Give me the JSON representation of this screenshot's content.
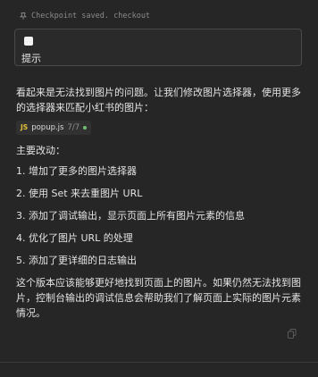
{
  "checkpoint": {
    "text": "Checkpoint saved. checkout"
  },
  "prompt": {
    "label": "提示"
  },
  "message": {
    "intro": "看起来是无法找到图片的问题。让我们修改图片选择器，使用更多的选择器来匹配小红书的图片：",
    "file": {
      "badge": "JS",
      "name": "popup.js",
      "meta": "7/7"
    },
    "heading": "主要改动：",
    "changes": [
      "1. 增加了更多的图片选择器",
      "2. 使用 Set 来去重图片 URL",
      "3. 添加了调试输出，显示页面上所有图片元素的信息",
      "4. 优化了图片 URL 的处理",
      "5. 添加了更详细的日志输出"
    ],
    "summary": "这个版本应该能够更好地找到页面上的图片。如果仍然无法找到图片，控制台输出的调试信息会帮助我们了解页面上实际的图片元素情况。"
  },
  "icons": {
    "checkpoint": "pin-icon",
    "copy": "copy-icon"
  },
  "colors": {
    "background": "#262626",
    "text": "#e3e3e3",
    "js_badge": "#e5c13b",
    "status_dot": "#6fc06f"
  }
}
